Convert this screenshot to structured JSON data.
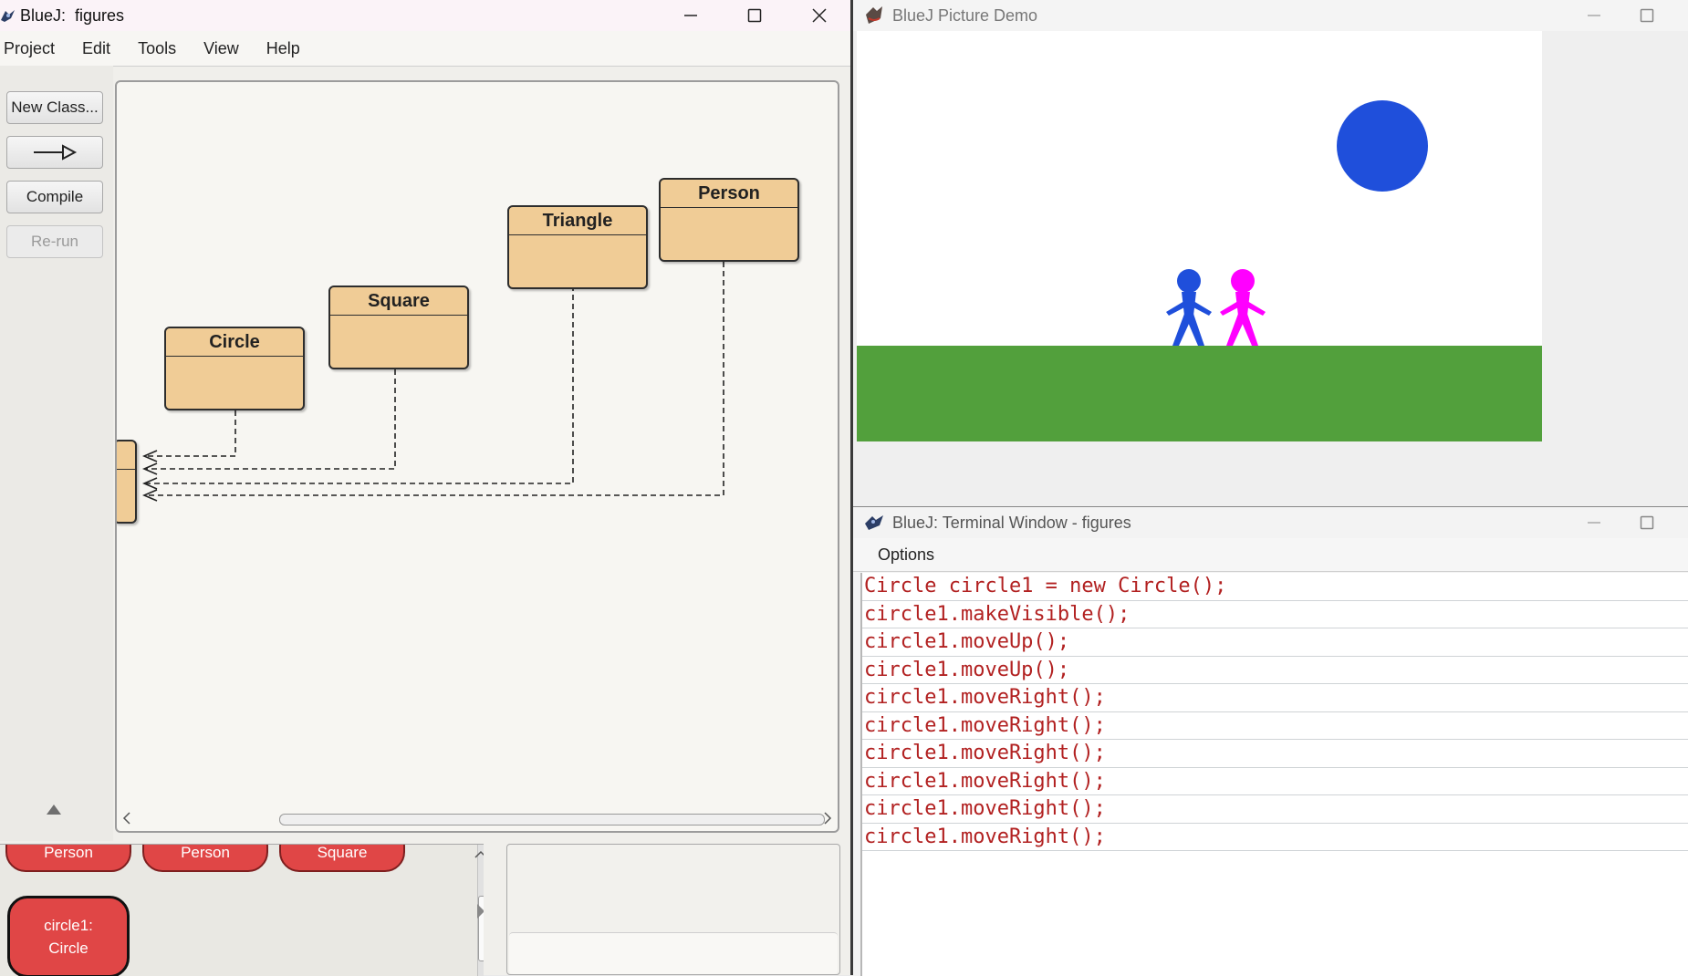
{
  "bluej_window": {
    "title": "BlueJ:  figures",
    "window_controls": [
      "minimize-icon",
      "maximize-icon",
      "close-icon"
    ],
    "menu": [
      "Project",
      "Edit",
      "Tools",
      "View",
      "Help"
    ],
    "toolbar": {
      "new_class_label": "New Class...",
      "arrow_icon": "inheritance-arrow-icon",
      "compile_label": "Compile",
      "rerun_label": "Re-run"
    },
    "diagram": {
      "classes": [
        "Circle",
        "Square",
        "Triangle",
        "Person"
      ],
      "partial_class_icon": "class-box-partial"
    },
    "object_bench": {
      "objects_partial": [
        "Person",
        "Person",
        "Square"
      ],
      "selected_object_line1": "circle1:",
      "selected_object_line2": "Circle"
    }
  },
  "picture_window": {
    "title": "BlueJ Picture Demo",
    "colors": {
      "sky": "#ffffff",
      "grass": "#52a03c",
      "sun": "#1f4fdb",
      "person1": "#1f4fdb",
      "person2": "#ff00ff"
    }
  },
  "terminal_window": {
    "title": "BlueJ: Terminal Window - figures",
    "menu_options": "Options",
    "lines": [
      "Circle circle1 = new Circle();",
      "circle1.makeVisible();",
      "circle1.moveUp();",
      "circle1.moveUp();",
      "circle1.moveRight();",
      "circle1.moveRight();",
      "circle1.moveRight();",
      "circle1.moveRight();",
      "circle1.moveRight();",
      "circle1.moveRight();"
    ]
  }
}
